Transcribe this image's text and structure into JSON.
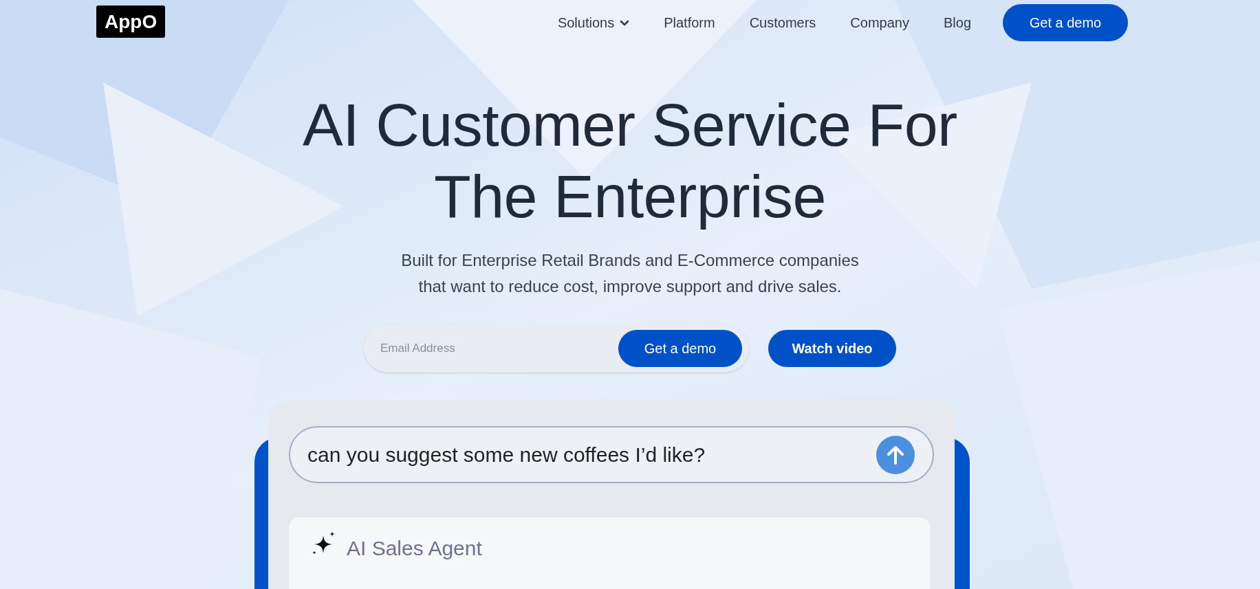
{
  "logo": "AppO",
  "nav": [
    {
      "label": "Solutions",
      "kind": "dropdown"
    },
    {
      "label": "Platform",
      "kind": "link"
    },
    {
      "label": "Customers",
      "kind": "link"
    },
    {
      "label": "Company",
      "kind": "link"
    },
    {
      "label": "Blog",
      "kind": "link"
    }
  ],
  "nav_cta": "Get a demo",
  "hero": {
    "title_lines": [
      "AI Customer Service For",
      "The Enterprise"
    ],
    "subtitle_lines": [
      "Built for Enterprise Retail Brands and E-Commerce companies",
      "that want to reduce cost, improve support and drive sales."
    ]
  },
  "signup": {
    "placeholder": "Email Address",
    "submit": "Get a demo",
    "secondary": "Watch video"
  },
  "chat": {
    "question": "can you suggest some new coffees I’d like?",
    "agent_label": "AI Sales Agent"
  }
}
